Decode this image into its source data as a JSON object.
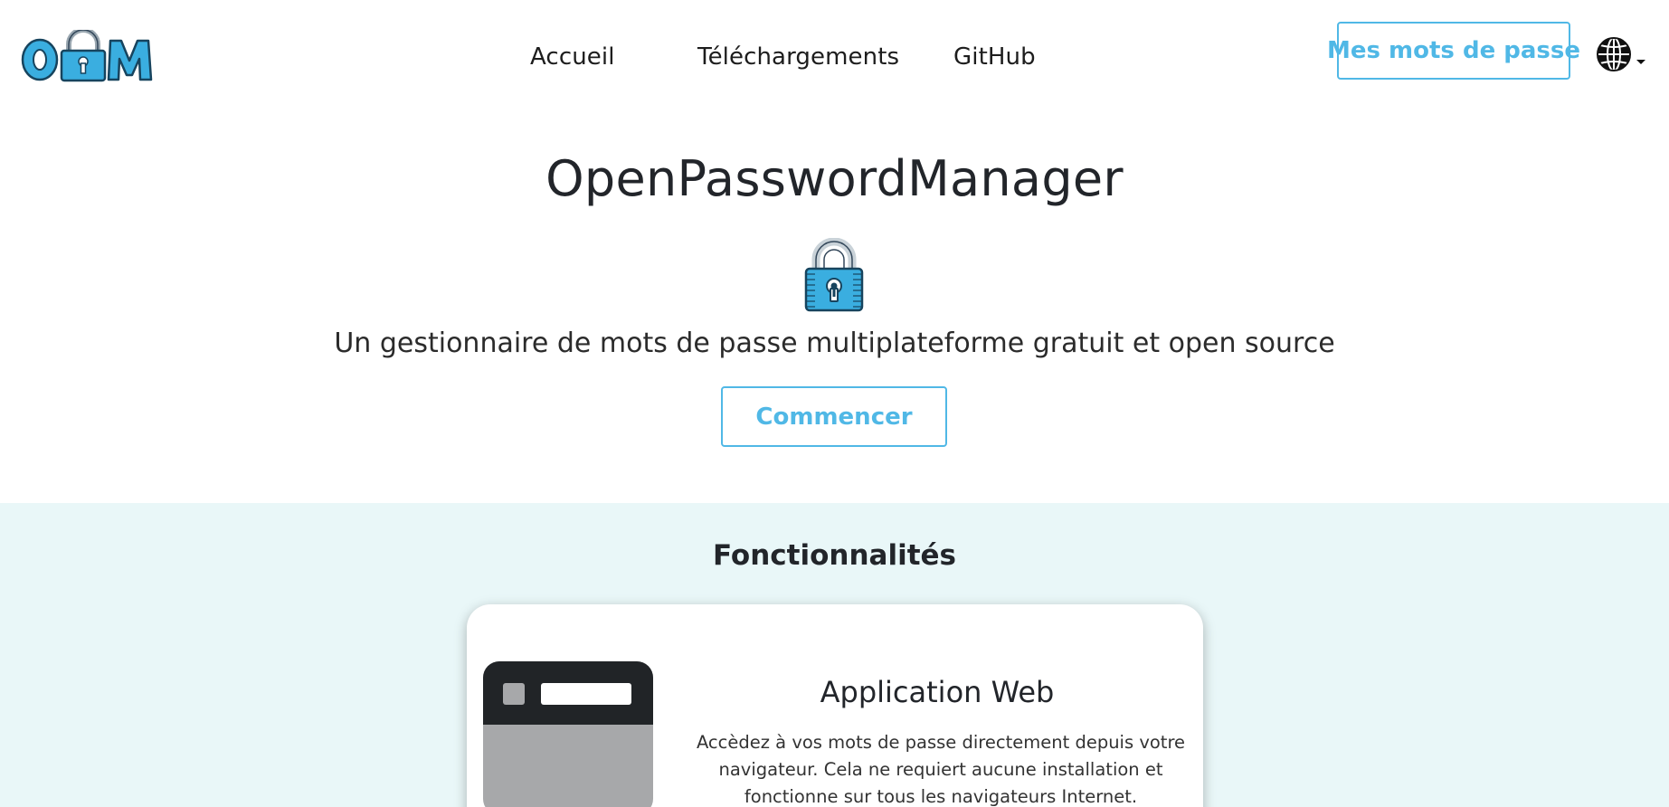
{
  "header": {
    "logo_label": "OPM",
    "nav": [
      {
        "label": "Accueil"
      },
      {
        "label": "Téléchargements"
      },
      {
        "label": "GitHub"
      }
    ],
    "passwords_button": "Mes mots de passe",
    "language_icon": "globe-icon"
  },
  "hero": {
    "title": "OpenPasswordManager",
    "lock_icon": "padlock-icon",
    "subtitle": "Un gestionnaire de mots de passe multiplateforme gratuit et open source",
    "start_button": "Commencer"
  },
  "features": {
    "title": "Fonctionnalités",
    "cards": [
      {
        "illustration": "browser-window-icon",
        "title": "Application Web",
        "text": "Accèdez à vos mots de passe directement depuis votre navigateur. Cela ne requiert aucune installation et fonctionne sur tous les navigateurs Internet."
      }
    ]
  },
  "colors": {
    "accent": "#50b8e6",
    "features_bg": "#e9f7f8",
    "text": "#212529"
  }
}
